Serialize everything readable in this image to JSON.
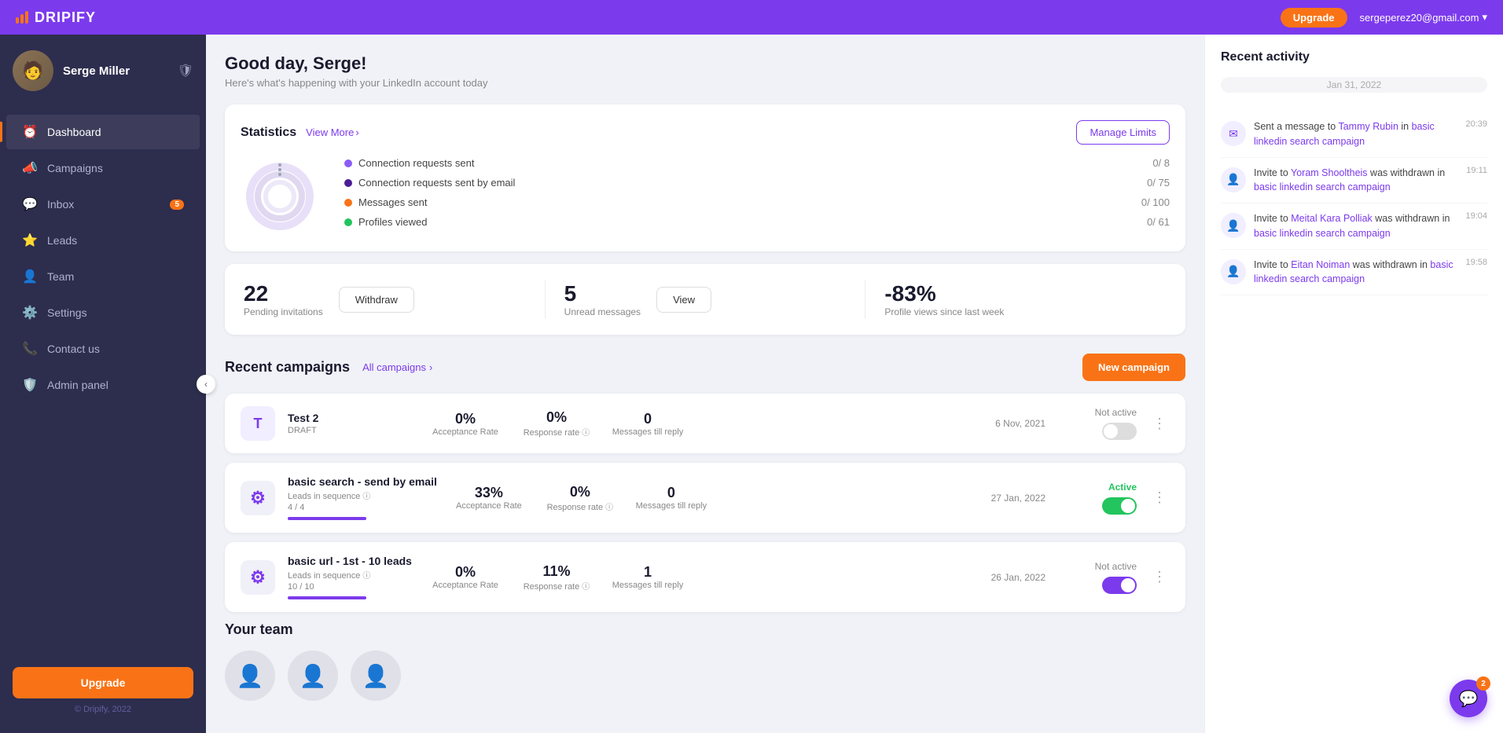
{
  "topnav": {
    "logo_text": "DRIPIFY",
    "upgrade_label": "Upgrade",
    "user_email": "sergeperez20@gmail.com"
  },
  "sidebar": {
    "user_name": "Serge Miller",
    "nav_items": [
      {
        "id": "dashboard",
        "label": "Dashboard",
        "icon": "⏰",
        "active": true,
        "badge": null
      },
      {
        "id": "campaigns",
        "label": "Campaigns",
        "icon": "📣",
        "active": false,
        "badge": null
      },
      {
        "id": "inbox",
        "label": "Inbox",
        "icon": "💬",
        "active": false,
        "badge": "5"
      },
      {
        "id": "leads",
        "label": "Leads",
        "icon": "⭐",
        "active": false,
        "badge": null
      },
      {
        "id": "team",
        "label": "Team",
        "icon": "👤",
        "active": false,
        "badge": null
      },
      {
        "id": "settings",
        "label": "Settings",
        "icon": "⚙️",
        "active": false,
        "badge": null
      },
      {
        "id": "contact",
        "label": "Contact us",
        "icon": "📞",
        "active": false,
        "badge": null
      },
      {
        "id": "admin",
        "label": "Admin panel",
        "icon": "🛡️",
        "active": false,
        "badge": null
      }
    ],
    "upgrade_btn": "Upgrade",
    "copyright": "© Dripify, 2022"
  },
  "greeting": {
    "title": "Good day, Serge!",
    "subtitle": "Here's what's happening with your LinkedIn account today"
  },
  "statistics": {
    "title": "Statistics",
    "view_more": "View More",
    "manage_limits": "Manage Limits",
    "legend": [
      {
        "label": "Connection requests sent",
        "value": "0/ 8",
        "color": "#8b5cf6"
      },
      {
        "label": "Connection requests sent by email",
        "value": "0/ 75",
        "color": "#6d28d9"
      },
      {
        "label": "Messages sent",
        "value": "0/ 100",
        "color": "#f97316"
      },
      {
        "label": "Profiles viewed",
        "value": "0/ 61",
        "color": "#22c55e"
      }
    ]
  },
  "metrics": [
    {
      "value": "22",
      "label1": "Pending",
      "label2": "invitations",
      "action": "Withdraw"
    },
    {
      "value": "5",
      "label1": "Unread",
      "label2": "messages",
      "action": "View"
    },
    {
      "value": "-83%",
      "label1": "Profile views",
      "label2": "since last week",
      "action": null
    }
  ],
  "campaigns": {
    "title": "Recent campaigns",
    "all_campaigns": "All campaigns",
    "new_campaign": "New campaign",
    "items": [
      {
        "name": "Test 2",
        "tag": "DRAFT",
        "icon_text": "T",
        "icon_type": "letter",
        "acceptance": "0%",
        "response": "0%",
        "messages": "0",
        "date": "6 Nov, 2021",
        "status": "Not active",
        "status_active": false,
        "progress_pct": 0,
        "progress_label": ""
      },
      {
        "name": "basic search - send by email",
        "tag": "Leads in sequence",
        "leads_count": "4 / 4",
        "icon_text": "⚙",
        "icon_type": "gear",
        "acceptance": "33%",
        "response": "0%",
        "messages": "0",
        "date": "27 Jan, 2022",
        "status": "Active",
        "status_active": true,
        "progress_pct": 100,
        "progress_label": ""
      },
      {
        "name": "basic url - 1st - 10 leads",
        "tag": "Leads in sequence",
        "leads_count": "10 / 10",
        "icon_text": "⚙",
        "icon_type": "gear",
        "acceptance": "0%",
        "response": "11%",
        "messages": "1",
        "date": "26 Jan, 2022",
        "status": "Not active",
        "status_active": false,
        "progress_pct": 100,
        "progress_label": ""
      }
    ]
  },
  "your_team": {
    "title": "Your team"
  },
  "recent_activity": {
    "title": "Recent activity",
    "date_label": "Jan 31, 2022",
    "items": [
      {
        "text_before": "Sent a message to",
        "link1": "Tammy Rubin",
        "text_middle": "in",
        "link2": "basic linkedin search campaign",
        "time": "20:39"
      },
      {
        "text_before": "Invite to",
        "link1": "Yoram Shooltheis",
        "text_middle": "was withdrawn in",
        "link2": "basic linkedin search campaign",
        "time": "19:11"
      },
      {
        "text_before": "Invite to",
        "link1": "Meital Kara Polliak",
        "text_middle": "was withdrawn in",
        "link2": "basic linkedin search campaign",
        "time": "19:04"
      },
      {
        "text_before": "Invite to",
        "link1": "Eitan Noiman",
        "text_middle": "was withdrawn in",
        "link2": "basic linkedin search campaign",
        "time": "19:58"
      }
    ]
  },
  "chat": {
    "badge": "2"
  }
}
